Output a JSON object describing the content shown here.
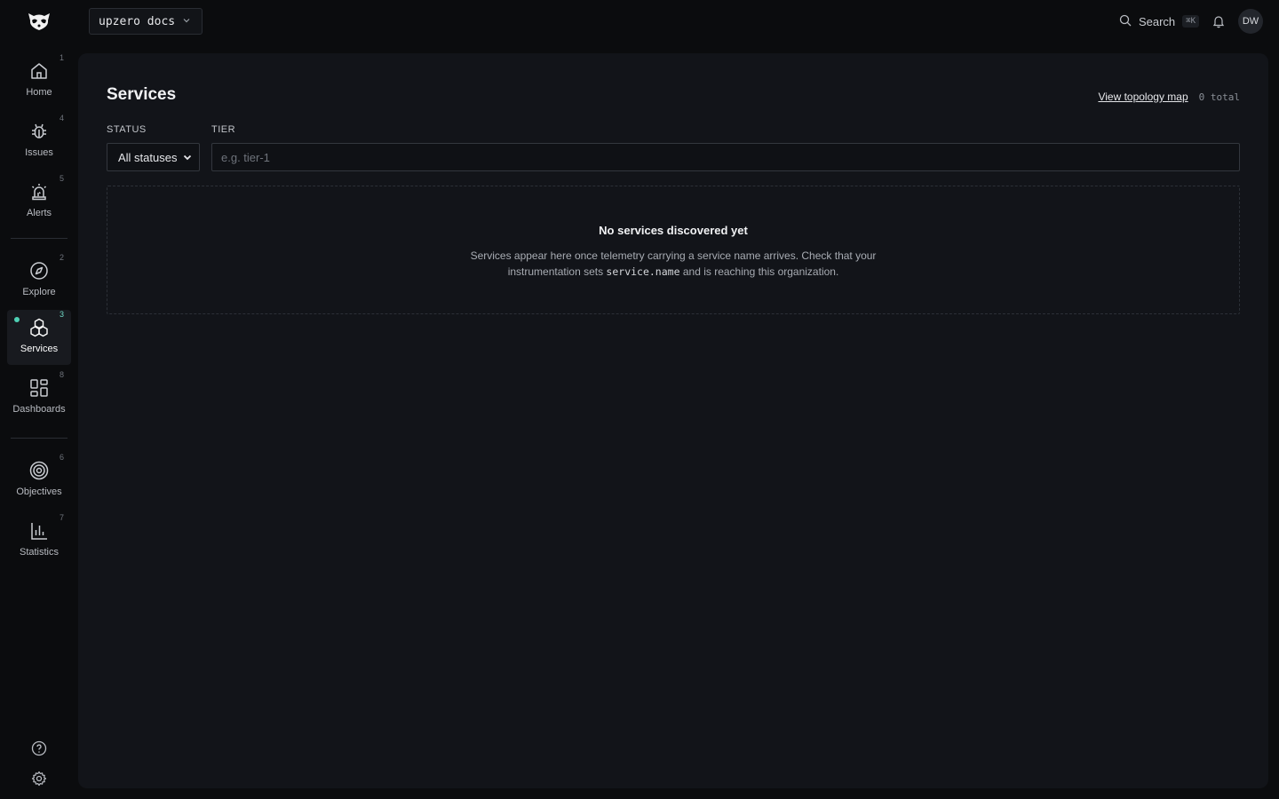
{
  "topbar": {
    "org_name": "upzero docs",
    "search_label": "Search",
    "search_shortcut": "⌘K",
    "user_initials": "DW"
  },
  "sidebar": {
    "items": [
      {
        "label": "Home",
        "shortcut": "1",
        "icon": "home-icon"
      },
      {
        "label": "Issues",
        "shortcut": "4",
        "icon": "bug-icon"
      },
      {
        "label": "Alerts",
        "shortcut": "5",
        "icon": "siren-icon"
      },
      {
        "label": "Explore",
        "shortcut": "2",
        "icon": "compass-icon"
      },
      {
        "label": "Services",
        "shortcut": "3",
        "icon": "cubes-icon",
        "active": true
      },
      {
        "label": "Dashboards",
        "shortcut": "8",
        "icon": "grid-icon"
      },
      {
        "label": "Objectives",
        "shortcut": "6",
        "icon": "target-icon"
      },
      {
        "label": "Statistics",
        "shortcut": "7",
        "icon": "bar-chart-icon"
      }
    ],
    "bottom": [
      "help-icon",
      "settings-icon"
    ]
  },
  "main": {
    "title": "Services",
    "topology_link": "View topology map",
    "total": "0 total",
    "filters": {
      "status_label": "STATUS",
      "status_value": "All statuses",
      "tier_label": "TIER",
      "tier_placeholder": "e.g. tier-1"
    },
    "empty": {
      "title": "No services discovered yet",
      "desc_before": "Services appear here once telemetry carrying a service name arrives. Check that your instrumentation sets ",
      "desc_code": "service.name",
      "desc_after": " and is reaching this organization."
    }
  },
  "colors": {
    "background": "#0b0c0e",
    "panel": "#121419",
    "accent": "#4fd1b5"
  }
}
